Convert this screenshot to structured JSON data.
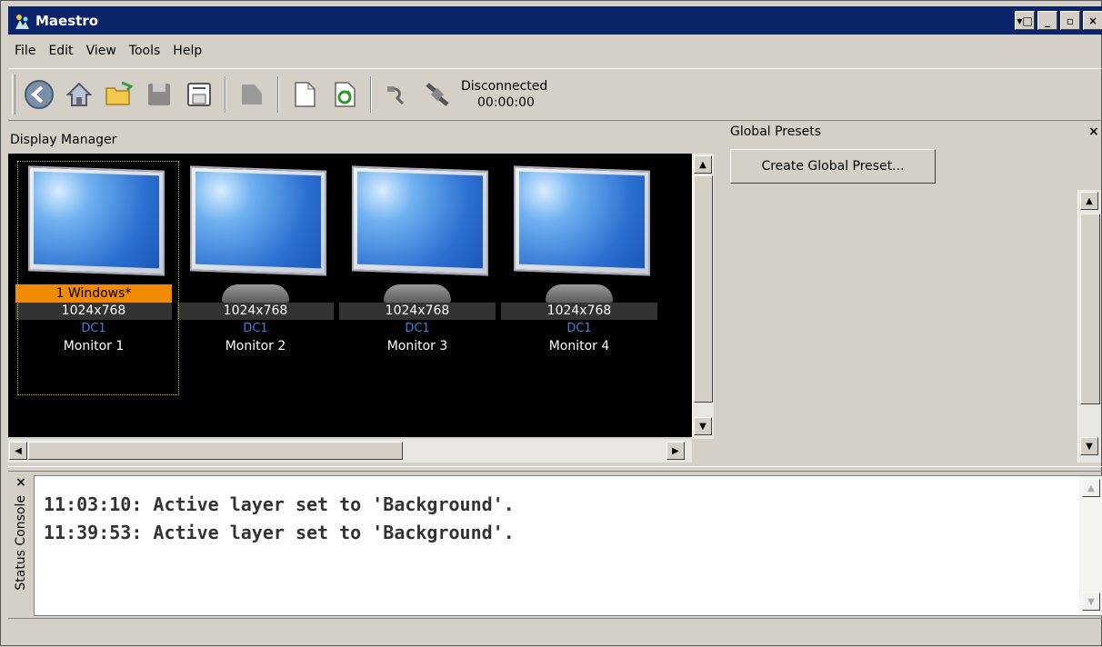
{
  "window": {
    "title": "Maestro",
    "buttons": [
      "▾□",
      "_",
      "▫",
      "×"
    ]
  },
  "menu": [
    "File",
    "Edit",
    "View",
    "Tools",
    "Help"
  ],
  "toolbar": {
    "icons": [
      "back-icon",
      "home-icon",
      "open-folder-icon",
      "save-icon",
      "save-as-icon",
      "disabled-page-icon",
      "new-page-icon",
      "refresh-icon",
      "connect-icon",
      "disconnect-icon"
    ],
    "status": "Disconnected",
    "timer": "00:00:00"
  },
  "display_manager": {
    "label": "Display Manager",
    "monitors": [
      {
        "windows": "1 Windows*",
        "resolution": "1024x768",
        "controller": "DC1",
        "name": "Monitor 1",
        "selected": true
      },
      {
        "windows": "",
        "resolution": "1024x768",
        "controller": "DC1",
        "name": "Monitor 2",
        "selected": false
      },
      {
        "windows": "",
        "resolution": "1024x768",
        "controller": "DC1",
        "name": "Monitor 3",
        "selected": false
      },
      {
        "windows": "",
        "resolution": "1024x768",
        "controller": "DC1",
        "name": "Monitor 4",
        "selected": false
      }
    ]
  },
  "global_presets": {
    "label": "Global Presets",
    "close": "×",
    "button": "Create Global Preset..."
  },
  "console": {
    "tab_label": "Status Console",
    "close": "×",
    "lines": [
      "11:03:10: Active layer set to 'Background'.",
      "11:39:53: Active layer set to 'Background'."
    ]
  },
  "colors": {
    "title_bar": "#0a246a",
    "window_badge": "#f08a00",
    "display_bg": "#000000",
    "controller_text": "#3d7fd0"
  }
}
